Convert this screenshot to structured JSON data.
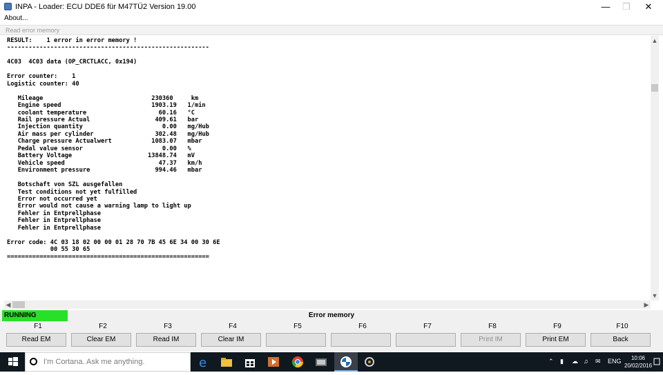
{
  "window": {
    "title": "INPA - Loader:  ECU DDE6 für M47TÜ2 Version 19.00",
    "menu": [
      "About..."
    ],
    "subtitle": "Read error memory"
  },
  "content": {
    "lines": [
      "RESULT:    1 error in error memory !",
      "--------------------------------------------------------",
      "",
      "4C03  4C03 data (OP_CRCTLACC, 0x194)",
      "",
      "Error counter:    1",
      "Logistic counter: 40",
      "",
      "   Mileage                              230360     km",
      "   Engine speed                         1903.19   1/min",
      "   coolant temperature                    60.16   °C",
      "   Rail pressure Actual                  409.61   bar",
      "   Injection quantity                      0.00   mg/Hub",
      "   Air mass per cylinder                 302.48   mg/Hub",
      "   Charge pressure Actualwert           1083.07   mbar",
      "   Pedal value sensor                      0.00   %",
      "   Battery Voltage                     13848.74   mV",
      "   Vehicle speed                          47.37   km/h",
      "   Environment pressure                  994.46   mbar",
      "",
      "   Botschaft von SZL ausgefallen",
      "   Test conditions not yet fulfilled",
      "   Error not occurred yet",
      "   Error would not cause a warning lamp to light up",
      "   Fehler in Entprellphase",
      "   Fehler in Entprellphase",
      "   Fehler in Entprellphase",
      "",
      "Error code: 4C 03 18 02 00 00 01 28 70 7B 45 6E 34 00 30 6E",
      "            00 55 30 65",
      "========================================================"
    ]
  },
  "status": {
    "state": "RUNNING",
    "state_color": "#28e028",
    "screen": "Error memory"
  },
  "fkeys": [
    {
      "key": "F1",
      "label": "Read EM",
      "enabled": true
    },
    {
      "key": "F2",
      "label": "Clear EM",
      "enabled": true
    },
    {
      "key": "F3",
      "label": "Read IM",
      "enabled": true
    },
    {
      "key": "F4",
      "label": "Clear IM",
      "enabled": true
    },
    {
      "key": "F5",
      "label": "",
      "enabled": true
    },
    {
      "key": "F6",
      "label": "",
      "enabled": true
    },
    {
      "key": "F7",
      "label": "",
      "enabled": true
    },
    {
      "key": "F8",
      "label": "Print IM",
      "enabled": false
    },
    {
      "key": "F9",
      "label": "Print EM",
      "enabled": true
    },
    {
      "key": "F10",
      "label": "Back",
      "enabled": true
    }
  ],
  "taskbar": {
    "search_placeholder": "I'm Cortana. Ask me anything.",
    "language": "ENG",
    "time": "10:06",
    "date": "20/02/2016",
    "apps": [
      "edge-icon",
      "file-explorer-icon",
      "store-icon",
      "media-player-icon",
      "chrome-icon",
      "photo-viewer-icon",
      "bmw-inpa-icon",
      "tools-icon"
    ]
  }
}
